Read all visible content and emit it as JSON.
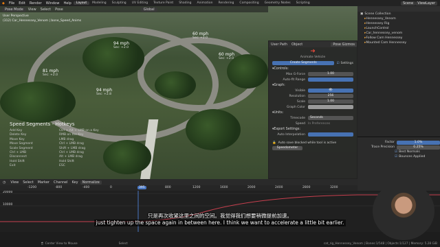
{
  "menu": {
    "items": [
      "File",
      "Edit",
      "Render",
      "Window",
      "Help"
    ],
    "tabs": [
      "Layout",
      "Modeling",
      "Sculpting",
      "UV Editing",
      "Texture Paint",
      "Shading",
      "Animation",
      "Rendering",
      "Compositing",
      "Geometry Nodes",
      "Scripting"
    ],
    "scene": "Scene",
    "view_layer": "ViewLayer"
  },
  "viewport": {
    "mode": "Pose Mode",
    "view_menu": [
      "View",
      "Select",
      "Pose"
    ],
    "orientation": "Global",
    "info_line1": "User Perspective",
    "info_line2": "(312) Car_Hennessey_Venom | bone_Speed_Anims",
    "markers": [
      {
        "speed": "60 mph",
        "sec": "Sec: +2.0"
      },
      {
        "speed": "94 mph",
        "sec": "Sec: +2.0"
      },
      {
        "speed": "60 mph",
        "sec": "Sec: +2.0"
      },
      {
        "speed": "81 mph",
        "sec": "Sec: +2.0"
      },
      {
        "speed": "94 mph",
        "sec": "Sec: +2.8"
      }
    ],
    "hotkeys": {
      "title": "Speed Segments - Hotkeys",
      "rows": [
        [
          "Add Key",
          "Ctrl + Alt + LMB on a Key"
        ],
        [
          "Delete Key",
          "RMB on the Key"
        ],
        [
          "Move Key",
          "LMB drag"
        ],
        [
          "Move Segment",
          "Ctrl + LMB drag"
        ],
        [
          "Scale Segment",
          "Shift + LMB drag"
        ],
        [
          "Ctrl + LMB",
          "Ctrl + LMB drag"
        ],
        [
          "Disconnect",
          "Alt + LMB drag"
        ],
        [
          "Hold Shift",
          "Hold Shift"
        ],
        [
          "Exit",
          "ESC"
        ]
      ]
    }
  },
  "npanel": {
    "tabs": [
      "User Path",
      "Object",
      "Pose Gizmos"
    ],
    "subtitle": "Animate Vehicle",
    "segments_btn": "Create Segments",
    "settings_btn": "Settings",
    "controls_head": "Controls:",
    "max_gforce_label": "Max G-Force",
    "max_gforce": "1.00",
    "auto_range_label": "Auto-fit Range",
    "graph_head": "Graph:",
    "visible_label": "Visible",
    "resolution_label": "Resolution",
    "resolution": "256",
    "scale_label": "Scale",
    "scale": "1.00",
    "graph_color_label": "Graph Color",
    "units_head": "Units:",
    "timecode_label": "Timecode",
    "timecode": "Seconds",
    "speed_label": "Speed",
    "speed": "In Preferences",
    "export_head": "Export Settings:",
    "auto_interp_label": "Auto Interpolation",
    "auto_save": "Auto save blocked while tool is active",
    "speedometer_btn": "Speedometer"
  },
  "outliner": {
    "root": "Scene Collection",
    "items": [
      "Hennessey_Venom",
      "Hennessey Rig",
      "LaunchControl",
      "Car_hennessey_venom",
      "Follow Cam Hennessey",
      "Mounted Cam Hennessey"
    ]
  },
  "props": {
    "factor_label": "Factor",
    "factor": "1.0%",
    "trace_label": "Trace Precision",
    "trace": "0.25%",
    "best_normals": "Best Normals",
    "bounces": "Bounces Applied"
  },
  "timeline": {
    "menus": [
      "View",
      "Select",
      "Marker",
      "Channel",
      "Key",
      "Normalize"
    ],
    "ticks": [
      "-1200",
      "-800",
      "-400",
      "0",
      "395",
      "800",
      "1200",
      "1600",
      "2000",
      "2400",
      "2800",
      "3200"
    ],
    "current_frame": "395",
    "y_labels": [
      "20000",
      "10000"
    ]
  },
  "status": {
    "left": "Center View to Mouse",
    "mid": "Select",
    "right": "cat_rig_Hennessey_Venom | Bones:1/548 | Objects:1/127 | Memory: 5.28 GiB"
  },
  "subtitles": {
    "zh": "只是再次收紧这里之间的空间。我觉得我们想要稍微提前加速。",
    "en": "just tighten up the space again in between here. I think we want to accelerate a little bit earlier."
  }
}
